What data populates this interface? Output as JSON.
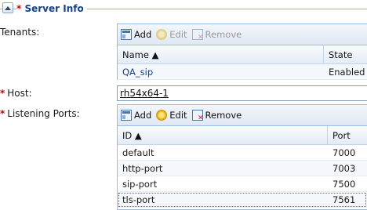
{
  "section": {
    "title": "Server Info"
  },
  "tenants": {
    "label": "Tenants:",
    "toolbar": {
      "add": "Add",
      "edit": "Edit",
      "remove": "Remove"
    },
    "columns": [
      "Name ▲",
      "State"
    ],
    "rows": [
      {
        "name": "QA_sip",
        "state": "Enabled"
      }
    ]
  },
  "host": {
    "label": "Host:",
    "value": "rh54x64-1"
  },
  "ports": {
    "label": "Listening Ports:",
    "toolbar": {
      "add": "Add",
      "edit": "Edit",
      "remove": "Remove"
    },
    "columns": [
      "ID ▲",
      "Port"
    ],
    "rows": [
      {
        "id": "default",
        "port": "7000"
      },
      {
        "id": "http-port",
        "port": "7003"
      },
      {
        "id": "sip-port",
        "port": "7500"
      },
      {
        "id": "tls-port",
        "port": "7561"
      }
    ]
  },
  "required_marker": "*",
  "colors": {
    "accent": "#15428b",
    "border": "#99bbe8",
    "required": "#cc0000"
  }
}
